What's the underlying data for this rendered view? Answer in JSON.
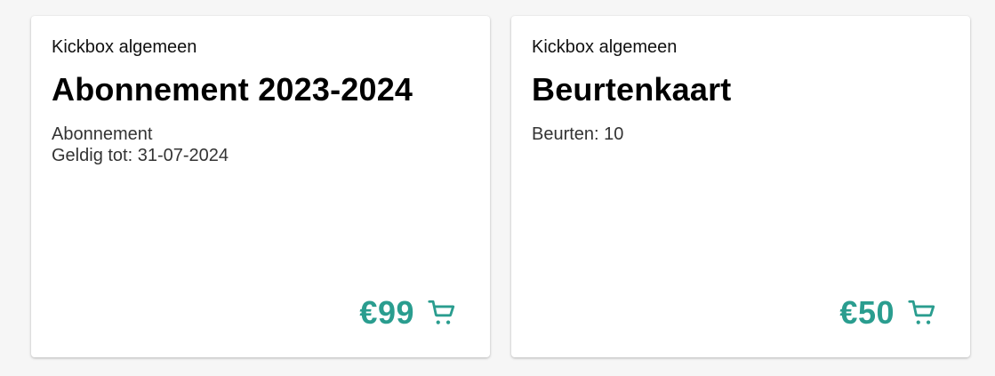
{
  "colors": {
    "accent": "#2a9d8f",
    "background": "#f6f6f6",
    "card": "#ffffff"
  },
  "products": [
    {
      "category": "Kickbox algemeen",
      "title": "Abonnement 2023-2024",
      "details": [
        "Abonnement",
        "Geldig tot: 31-07-2024"
      ],
      "price": "€99",
      "icon": "cart-icon"
    },
    {
      "category": "Kickbox algemeen",
      "title": "Beurtenkaart",
      "details": [
        "Beurten: 10"
      ],
      "price": "€50",
      "icon": "cart-icon"
    }
  ]
}
